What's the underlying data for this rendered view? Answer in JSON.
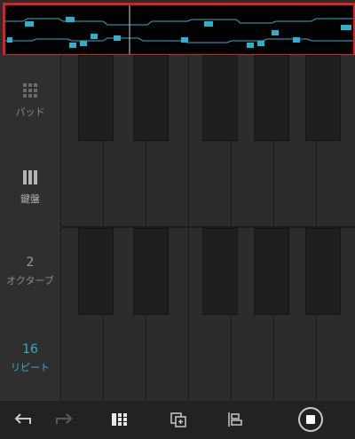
{
  "sidebar": {
    "pad": {
      "label": "パッド"
    },
    "keyboard": {
      "label": "鍵盤"
    },
    "octave": {
      "value": "2",
      "label": "オクターブ"
    },
    "repeat": {
      "value": "16",
      "label": "リピート"
    }
  },
  "toolbar": {
    "buttons": [
      "undo-icon",
      "redo-icon",
      "pad-layout-icon",
      "duplicate-icon",
      "align-icon",
      "record-stop-icon"
    ]
  },
  "colors": {
    "accent": "#2db0cc",
    "highlight_border": "#e02020",
    "background": "#2a2a2a"
  }
}
